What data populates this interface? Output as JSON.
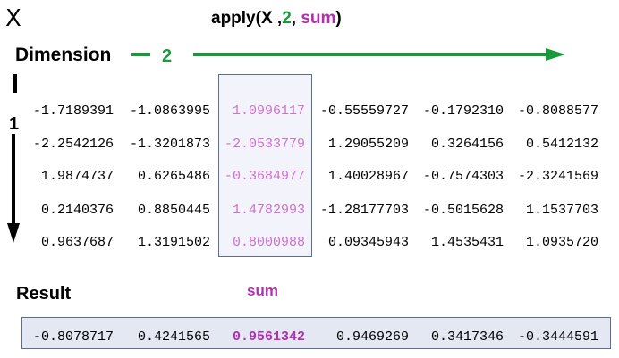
{
  "matrix_name": "X",
  "apply_call": {
    "prefix": "apply(X ,",
    "margin": "2",
    "separator": ", ",
    "function": "sum",
    "suffix": ")"
  },
  "dimension_label": "Dimension",
  "dim1": "1",
  "dim2": "2",
  "matrix": [
    [
      "-1.7189391",
      "-1.0863995",
      "1.0996117",
      "-0.55559727",
      "-0.1792310",
      "-0.8088577"
    ],
    [
      "-2.2542126",
      "-1.3201873",
      "-2.0533779",
      "1.29055209",
      "0.3264156",
      "0.5412132"
    ],
    [
      "1.9874737",
      "0.6265486",
      "-0.3684977",
      "1.40028967",
      "-0.7574303",
      "-2.3241569"
    ],
    [
      "0.2140376",
      "0.8850445",
      "1.4782993",
      "-1.28177703",
      "-0.5015628",
      "1.1537703"
    ],
    [
      "0.9637687",
      "1.3191502",
      "0.8000988",
      "0.09345943",
      "1.4535431",
      "1.0935720"
    ]
  ],
  "highlighted_column": 3,
  "result_label": "Result",
  "sum_label": "sum",
  "result": [
    "-0.8078717",
    "0.4241565",
    "0.9561342",
    "0.9469269",
    "0.3417346",
    "-0.3444591"
  ],
  "colors": {
    "green": "#1a9a3a",
    "purple": "#b030b0",
    "highlight_text": "#d070d0",
    "highlight_box": "#f3f3fb",
    "result_box": "#e3e8f2",
    "box_border": "#5a6e90"
  }
}
